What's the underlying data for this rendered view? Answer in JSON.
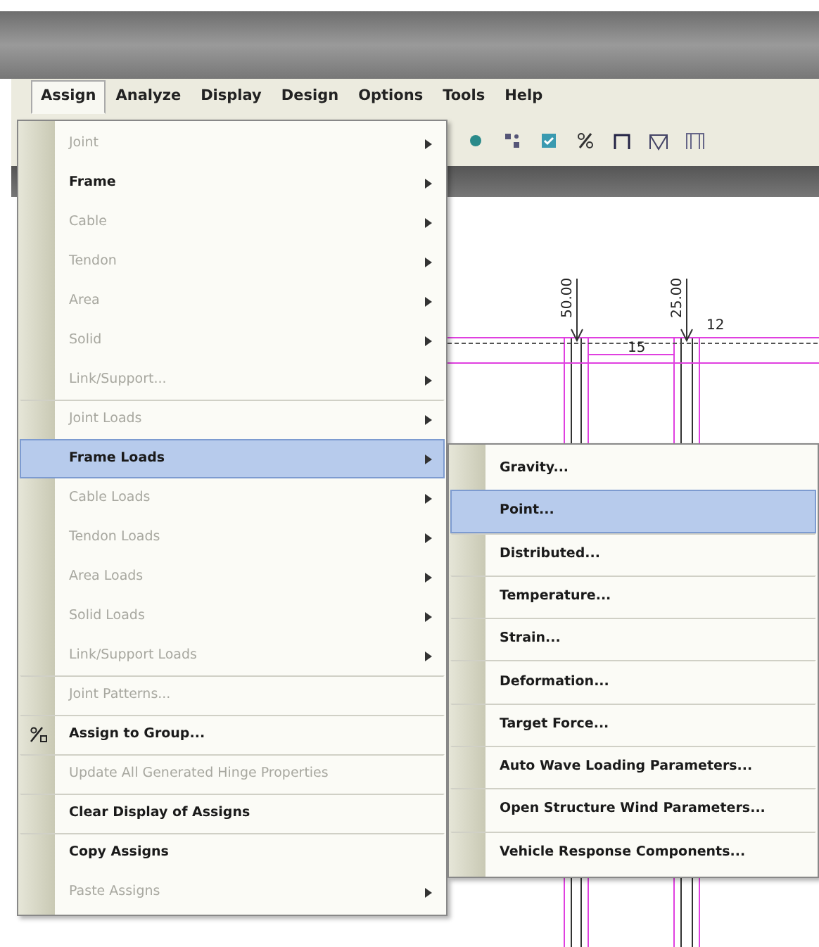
{
  "menubar": [
    {
      "label": "Assign",
      "selected": true
    },
    {
      "label": "Analyze",
      "selected": false
    },
    {
      "label": "Display",
      "selected": false
    },
    {
      "label": "Design",
      "selected": false
    },
    {
      "label": "Options",
      "selected": false
    },
    {
      "label": "Tools",
      "selected": false
    },
    {
      "label": "Help",
      "selected": false
    }
  ],
  "canvas": {
    "labels": [
      "50.00",
      "25.00",
      "15",
      "12"
    ]
  },
  "menu": [
    {
      "label": "Joint",
      "disabled": true,
      "submenu": true,
      "selected": false,
      "separator_before": false
    },
    {
      "label": "Frame",
      "disabled": false,
      "submenu": true,
      "selected": false,
      "separator_before": false
    },
    {
      "label": "Cable",
      "disabled": true,
      "submenu": true,
      "selected": false,
      "separator_before": false
    },
    {
      "label": "Tendon",
      "disabled": true,
      "submenu": true,
      "selected": false,
      "separator_before": false
    },
    {
      "label": "Area",
      "disabled": true,
      "submenu": true,
      "selected": false,
      "separator_before": false
    },
    {
      "label": "Solid",
      "disabled": true,
      "submenu": true,
      "selected": false,
      "separator_before": false
    },
    {
      "label": "Link/Support...",
      "disabled": true,
      "submenu": true,
      "selected": false,
      "separator_before": false
    },
    {
      "label": "Joint Loads",
      "disabled": true,
      "submenu": true,
      "selected": false,
      "separator_before": true
    },
    {
      "label": "Frame Loads",
      "disabled": false,
      "submenu": true,
      "selected": true,
      "separator_before": false
    },
    {
      "label": "Cable Loads",
      "disabled": true,
      "submenu": true,
      "selected": false,
      "separator_before": false
    },
    {
      "label": "Tendon Loads",
      "disabled": true,
      "submenu": true,
      "selected": false,
      "separator_before": false
    },
    {
      "label": "Area Loads",
      "disabled": true,
      "submenu": true,
      "selected": false,
      "separator_before": false
    },
    {
      "label": "Solid Loads",
      "disabled": true,
      "submenu": true,
      "selected": false,
      "separator_before": false
    },
    {
      "label": "Link/Support Loads",
      "disabled": true,
      "submenu": true,
      "selected": false,
      "separator_before": false
    },
    {
      "label": "Joint Patterns...",
      "disabled": true,
      "submenu": false,
      "selected": false,
      "separator_before": true
    },
    {
      "label": "Assign to Group...",
      "disabled": false,
      "submenu": false,
      "selected": false,
      "separator_before": true,
      "kind": "group"
    },
    {
      "label": "Update All Generated Hinge Properties",
      "disabled": true,
      "submenu": false,
      "selected": false,
      "separator_before": true
    },
    {
      "label": "Clear Display of Assigns",
      "disabled": false,
      "submenu": false,
      "selected": false,
      "separator_before": true
    },
    {
      "label": "Copy Assigns",
      "disabled": false,
      "submenu": false,
      "selected": false,
      "separator_before": true
    },
    {
      "label": "Paste Assigns",
      "disabled": true,
      "submenu": true,
      "selected": false,
      "separator_before": false
    }
  ],
  "submenu": [
    {
      "label": "Gravity...",
      "selected": false
    },
    {
      "label": "Point...",
      "selected": true
    },
    {
      "label": "Distributed...",
      "selected": false
    },
    {
      "label": "Temperature...",
      "selected": false
    },
    {
      "label": "Strain...",
      "selected": false
    },
    {
      "label": "Deformation...",
      "selected": false
    },
    {
      "label": "Target Force...",
      "selected": false
    },
    {
      "label": "Auto Wave Loading Parameters...",
      "selected": false
    },
    {
      "label": "Open Structure Wind Parameters...",
      "selected": false
    },
    {
      "label": "Vehicle Response Components...",
      "selected": false
    }
  ]
}
